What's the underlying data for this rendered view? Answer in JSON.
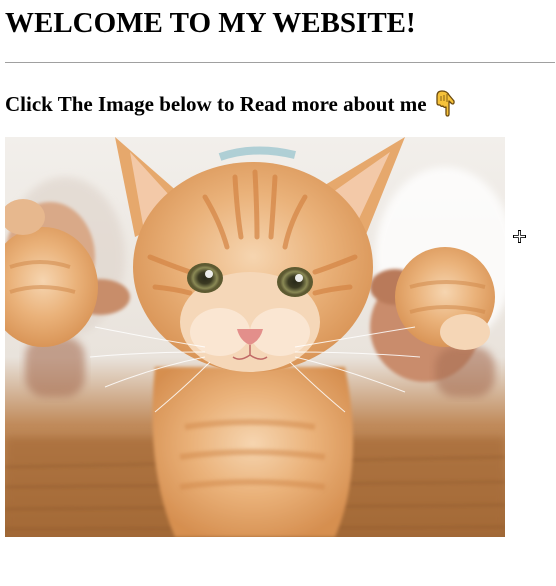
{
  "page": {
    "title": "WELCOME TO MY WEBSITE!",
    "subtitle": "Click The Image below to Read more about me"
  },
  "icons": {
    "subtitle_icon": "pointing-down-hand-icon",
    "cursor": "crosshair-cursor-icon"
  },
  "image": {
    "subject": "kitten-photo",
    "link": true
  },
  "colors": {
    "text": "#000000",
    "divider": "#a0a0a0",
    "background": "#ffffff",
    "hand": "#f6c23a"
  }
}
